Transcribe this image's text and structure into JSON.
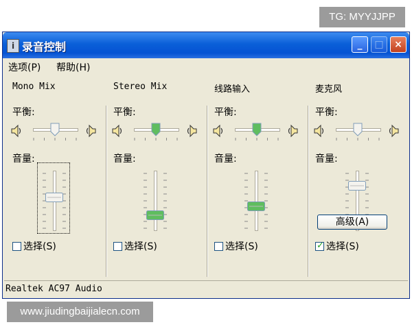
{
  "watermarks": {
    "top": "TG: MYYJJPP",
    "bottom": "www.jiudingbaijialecn.com"
  },
  "window": {
    "title": "录音控制",
    "controls": {
      "minimize": "_",
      "maximize": "□",
      "close": "×"
    }
  },
  "menu": [
    {
      "label": "选项(P)"
    },
    {
      "label": "帮助(H)"
    }
  ],
  "columns": [
    {
      "name": "Mono Mix",
      "balance_label": "平衡:",
      "volume_label": "音量:",
      "select_label": "选择(S)",
      "selected": false,
      "volume": 0.55,
      "balance": 0.5
    },
    {
      "name": "Stereo Mix",
      "balance_label": "平衡:",
      "volume_label": "音量:",
      "select_label": "选择(S)",
      "selected": false,
      "volume": 0.25,
      "balance": 0.5
    },
    {
      "name": "线路输入",
      "balance_label": "平衡:",
      "volume_label": "音量:",
      "select_label": "选择(S)",
      "selected": false,
      "volume": 0.4,
      "balance": 0.5
    },
    {
      "name": "麦克风",
      "balance_label": "平衡:",
      "volume_label": "音量:",
      "select_label": "选择(S)",
      "selected": true,
      "volume": 0.75,
      "balance": 0.5
    }
  ],
  "advanced_button": "高级(A)",
  "status": "Realtek AC97 Audio",
  "icons": [
    "app-icon",
    "speaker-left-icon",
    "speaker-right-icon",
    "checkmark-icon"
  ],
  "colors": {
    "titlebar": "#0553d3",
    "window_bg": "#ece9d8",
    "thumb_green": "#5fbd5f",
    "check_green": "#21a121"
  }
}
